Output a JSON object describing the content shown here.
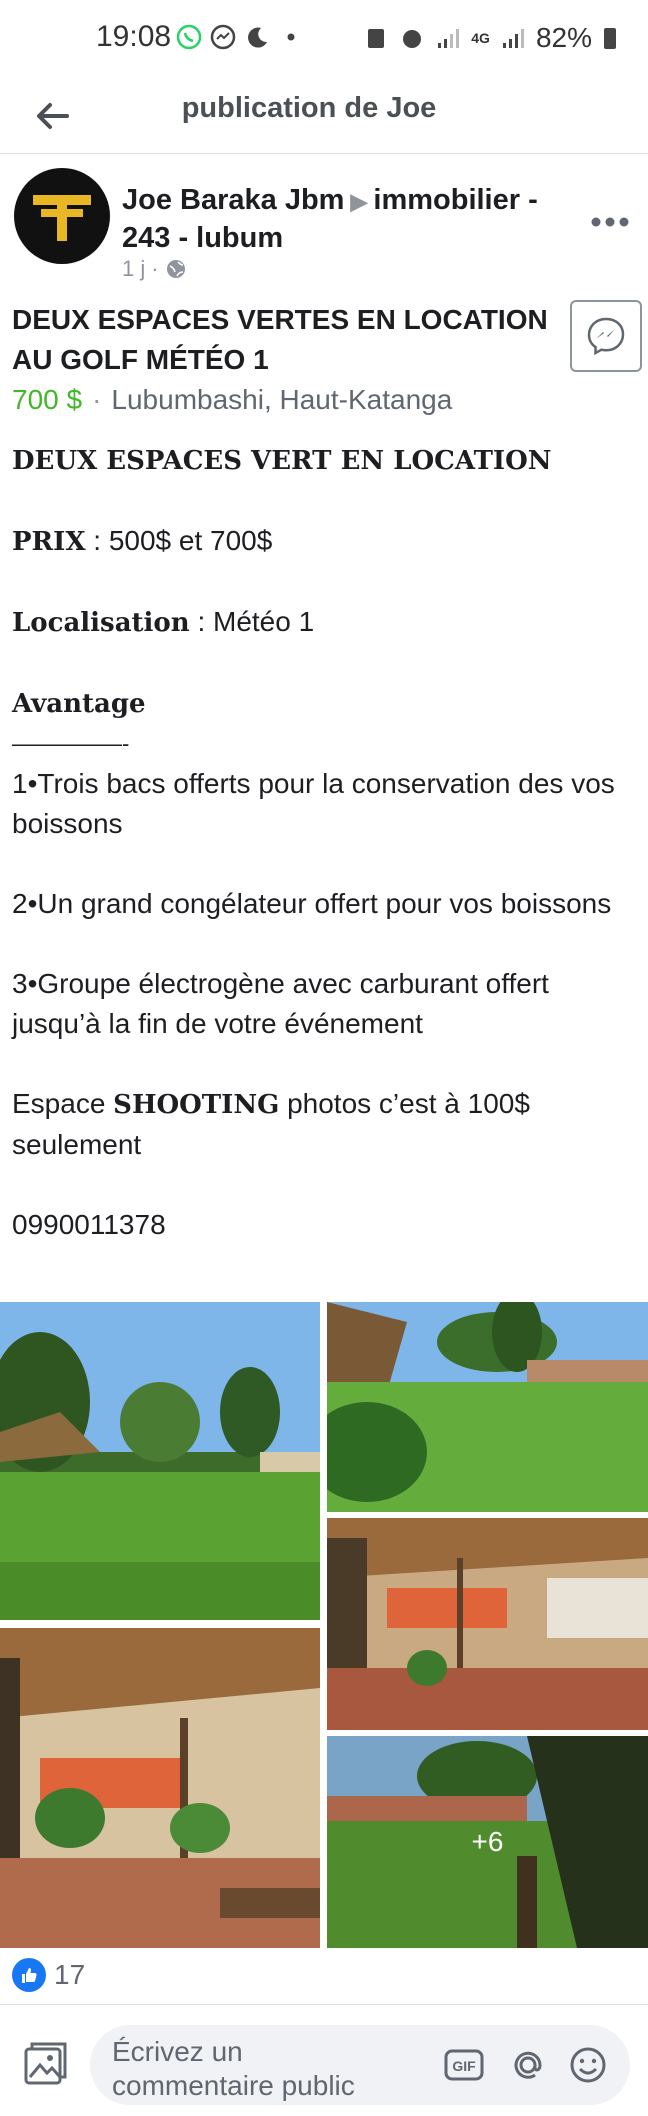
{
  "status_bar": {
    "time": "19:08",
    "network": "4G",
    "battery": "82%"
  },
  "header": {
    "title": "publication de Joe"
  },
  "post": {
    "author": "Joe Baraka Jbm",
    "group": "immobilier - 243 - lubum",
    "time_ago": "1 j",
    "audience_icon": "globe-icon",
    "listing_title": "DEUX ESPACES VERTES EN LOCATION AU GOLF MÉTÉO 1",
    "price": "700 $",
    "location": "Lubumbashi, Haut-Katanga",
    "body": {
      "heading": "DEUX ESPACES VERT EN LOCATION",
      "prix_label": "PRIX",
      "prix_value": " : 500$ et 700$",
      "loc_label": "Localisation",
      "loc_value": " : Météo 1",
      "avantage_label": "Avantage",
      "divider": "—————-",
      "item1": "1•Trois bacs offerts pour la conservation des vos boissons",
      "item2": "2•Un grand congélateur offert pour vos boissons",
      "item3": "3•Groupe électrogène avec carburant offert jusqu’à la fin de votre événement",
      "shooting_prefix": "Espace ",
      "shooting_label": "SHOOTING",
      "shooting_suffix": " photos c’est à 100$ seulement",
      "phone": "0990011378"
    },
    "more_photos": "+6",
    "reactions_count": "17"
  },
  "comment_bar": {
    "placeholder": "Écrivez un commentaire public"
  },
  "colors": {
    "accent": "#1877f2",
    "price_green": "#42b72a",
    "meta_gray": "#90949c"
  }
}
